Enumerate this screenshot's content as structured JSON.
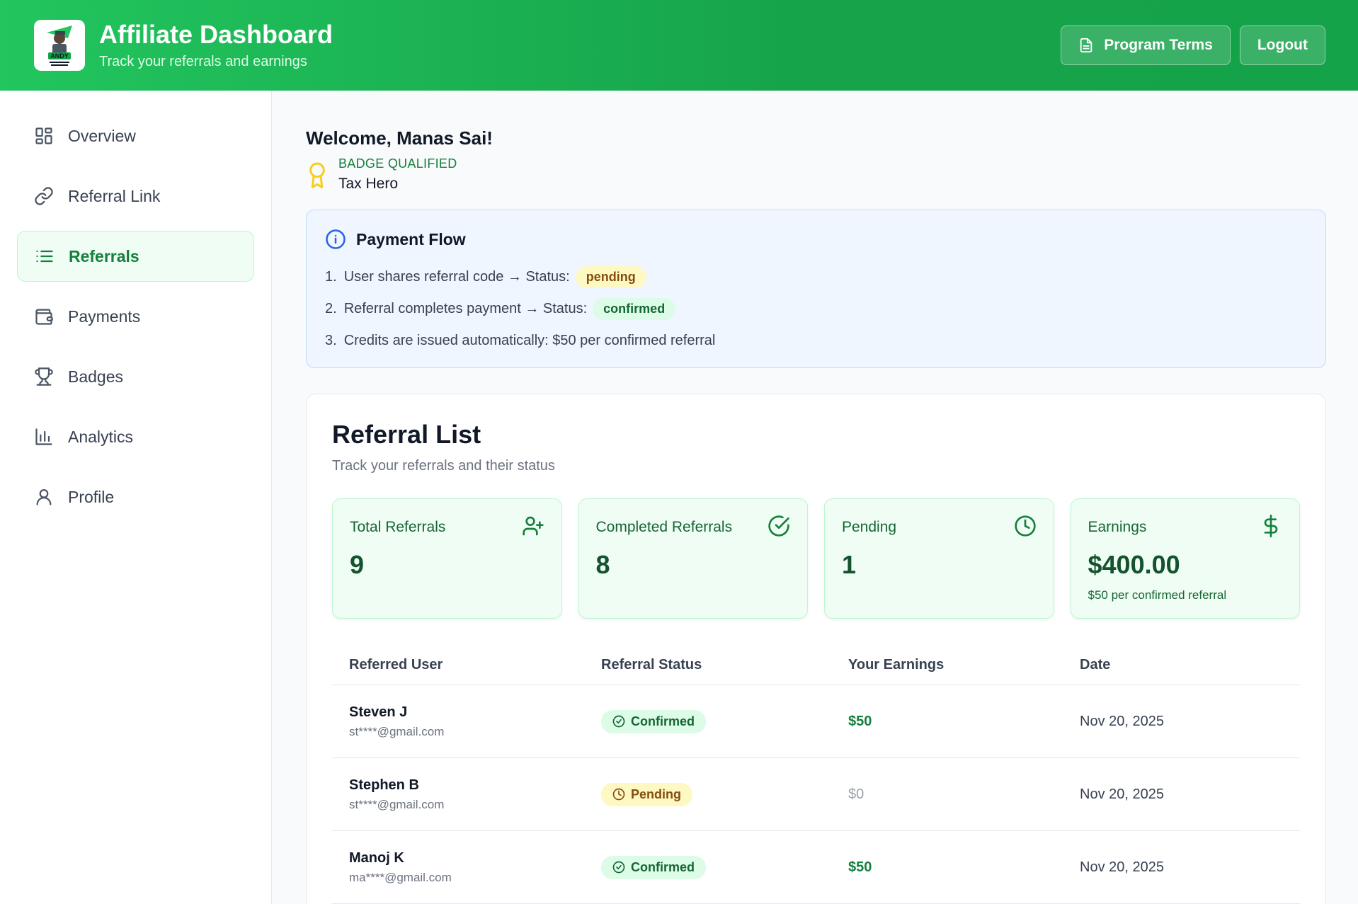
{
  "header": {
    "title": "Affiliate Dashboard",
    "subtitle": "Track your referrals and earnings",
    "logo_text": "ANDY",
    "program_terms_label": "Program Terms",
    "logout_label": "Logout"
  },
  "sidebar": {
    "items": [
      {
        "label": "Overview",
        "icon": "grid-icon"
      },
      {
        "label": "Referral Link",
        "icon": "link-icon"
      },
      {
        "label": "Referrals",
        "icon": "list-icon",
        "active": true
      },
      {
        "label": "Payments",
        "icon": "wallet-icon"
      },
      {
        "label": "Badges",
        "icon": "trophy-icon"
      },
      {
        "label": "Analytics",
        "icon": "bar-chart-icon"
      },
      {
        "label": "Profile",
        "icon": "user-icon"
      }
    ]
  },
  "welcome": {
    "greeting": "Welcome, Manas Sai!",
    "badge_label": "BADGE QUALIFIED",
    "badge_name": "Tax Hero"
  },
  "payment_flow": {
    "title": "Payment Flow",
    "steps": [
      {
        "num": "1.",
        "text": "User shares referral code → Status:",
        "pill": "pending"
      },
      {
        "num": "2.",
        "text": "Referral completes payment → Status:",
        "pill": "confirmed"
      },
      {
        "num": "3.",
        "text": "Credits are issued automatically: $50 per confirmed referral"
      }
    ]
  },
  "referral_list": {
    "title": "Referral List",
    "subtitle": "Track your referrals and their status",
    "stats": [
      {
        "label": "Total Referrals",
        "value": "9",
        "icon": "user-plus-icon"
      },
      {
        "label": "Completed Referrals",
        "value": "8",
        "icon": "check-circle-icon"
      },
      {
        "label": "Pending",
        "value": "1",
        "icon": "clock-icon"
      },
      {
        "label": "Earnings",
        "value": "$400.00",
        "note": "$50 per confirmed referral",
        "icon": "dollar-icon"
      }
    ],
    "columns": [
      "Referred User",
      "Referral Status",
      "Your Earnings",
      "Date"
    ],
    "rows": [
      {
        "name": "Steven J",
        "email": "st****@gmail.com",
        "status": "Confirmed",
        "earnings": "$50",
        "date": "Nov 20, 2025"
      },
      {
        "name": "Stephen B",
        "email": "st****@gmail.com",
        "status": "Pending",
        "earnings": "$0",
        "date": "Nov 20, 2025"
      },
      {
        "name": "Manoj K",
        "email": "ma****@gmail.com",
        "status": "Confirmed",
        "earnings": "$50",
        "date": "Nov 20, 2025"
      }
    ]
  },
  "colors": {
    "header_green": "#22c55e",
    "accent_green": "#15803d",
    "info_blue": "#2563eb",
    "pending_yellow": "#fef9c3"
  }
}
